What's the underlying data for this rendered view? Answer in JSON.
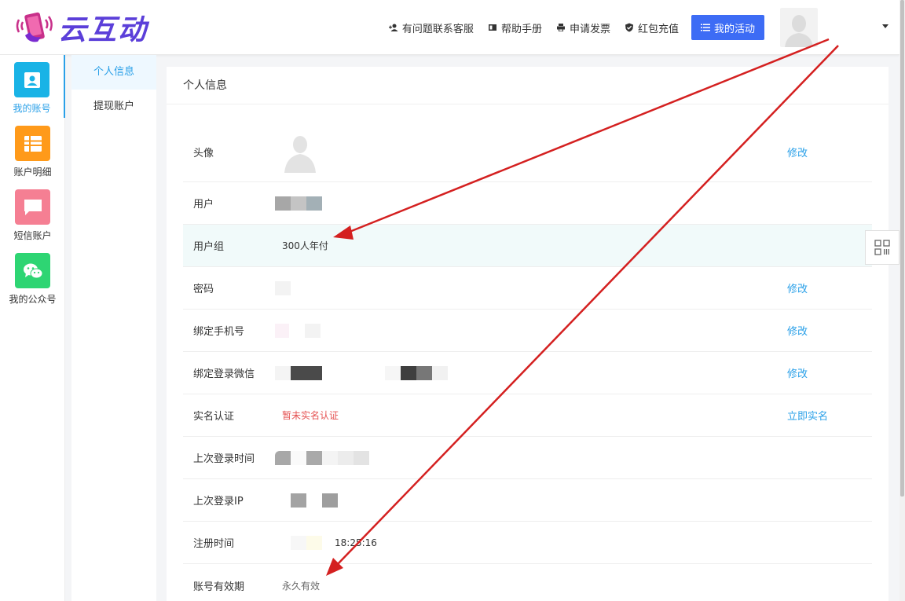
{
  "brand": {
    "name": "云互动"
  },
  "header": {
    "nav": [
      {
        "label": "有问题联系客服",
        "icon": "add-user-icon"
      },
      {
        "label": "帮助手册",
        "icon": "book-icon"
      },
      {
        "label": "申请发票",
        "icon": "printer-icon"
      },
      {
        "label": "红包充值",
        "icon": "shield-check-icon"
      }
    ],
    "activity_label": "我的活动"
  },
  "iconbar": [
    {
      "label": "我的账号",
      "color": "#19b3e6",
      "icon": "account-icon"
    },
    {
      "label": "账户明细",
      "color": "#ff9a1a",
      "icon": "list-icon"
    },
    {
      "label": "短信账户",
      "color": "#f57f93",
      "icon": "message-icon"
    },
    {
      "label": "我的公众号",
      "color": "#2ed573",
      "icon": "wechat-icon"
    }
  ],
  "submenu": [
    {
      "label": "个人信息"
    },
    {
      "label": "提现账户"
    }
  ],
  "panel": {
    "title": "个人信息",
    "rows": {
      "avatar": {
        "label": "头像",
        "action": "修改"
      },
      "user": {
        "label": "用户"
      },
      "group": {
        "label": "用户组",
        "value": "300人年付"
      },
      "password": {
        "label": "密码",
        "action": "修改"
      },
      "phone": {
        "label": "绑定手机号",
        "action": "修改"
      },
      "wechat": {
        "label": "绑定登录微信",
        "action": "修改"
      },
      "realname": {
        "label": "实名认证",
        "value": "暂未实名认证",
        "action": "立即实名"
      },
      "last_login_time": {
        "label": "上次登录时间"
      },
      "last_login_ip": {
        "label": "上次登录IP"
      },
      "register_time": {
        "label": "注册时间",
        "value": "18:25:16"
      },
      "expiry": {
        "label": "账号有效期",
        "value": "永久有效"
      }
    }
  },
  "colors": {
    "accent": "#2aa0e8",
    "primary_button": "#3d6cf5",
    "annotation": "#d42020"
  }
}
